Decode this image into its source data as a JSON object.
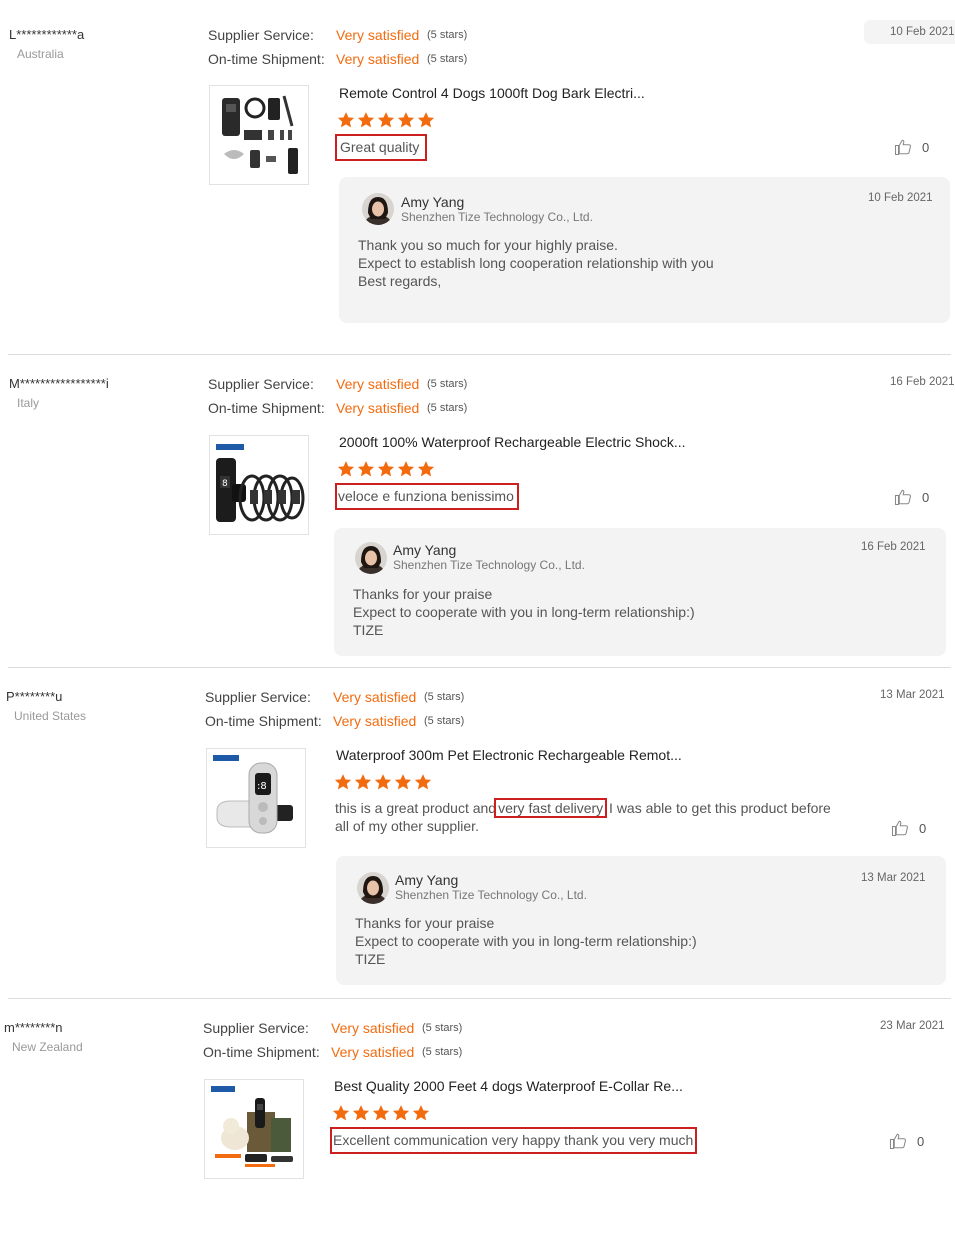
{
  "labels": {
    "supplier_service": "Supplier Service:",
    "ontime_shipment": "On-time Shipment:",
    "like_count": "0"
  },
  "colors": {
    "accent": "#f26b0f",
    "highlight_box": "#cc1f1f",
    "star": "#f26b0f"
  },
  "reviews": [
    {
      "buyer": "L************a",
      "country": "Australia",
      "date": "10 Feb 2021",
      "supplier_service_value": "Very satisfied",
      "supplier_service_stars": "(5 stars)",
      "shipment_value": "Very satisfied",
      "shipment_stars": "(5 stars)",
      "product_title": "Remote Control 4 Dogs 1000ft Dog Bark Electri...",
      "rating": 5,
      "comment": "Great quality",
      "likes": "0",
      "reply": {
        "name": "Amy Yang",
        "company": "Shenzhen Tize Technology Co., Ltd.",
        "date": "10 Feb 2021",
        "lines": [
          "Thank you so much for your highly praise.",
          "Expect to establish long cooperation relationship with you",
          "Best regards,"
        ]
      }
    },
    {
      "buyer": "M*****************i",
      "country": "Italy",
      "date": "16 Feb 2021",
      "supplier_service_value": "Very satisfied",
      "supplier_service_stars": "(5 stars)",
      "shipment_value": "Very satisfied",
      "shipment_stars": "(5 stars)",
      "product_title": "2000ft 100% Waterproof Rechargeable Electric Shock...",
      "rating": 5,
      "comment": "veloce e funziona benissimo",
      "likes": "0",
      "reply": {
        "name": "Amy Yang",
        "company": "Shenzhen Tize Technology Co., Ltd.",
        "date": "16 Feb 2021",
        "lines": [
          "Thanks for your praise",
          "Expect to cooperate with you in long-term relationship:)",
          "TIZE"
        ]
      }
    },
    {
      "buyer": "P********u",
      "country": "United States",
      "date": "13 Mar 2021",
      "supplier_service_value": "Very satisfied",
      "supplier_service_stars": "(5 stars)",
      "shipment_value": "Very satisfied",
      "shipment_stars": "(5 stars)",
      "product_title": "Waterproof 300m Pet Electronic Rechargeable Remot...",
      "rating": 5,
      "comment_before": "this is a great product and",
      "comment_highlight": "very fast delivery",
      "comment_after": " I was able to get this product before",
      "comment_line2": "all of my other supplier.",
      "likes": "0",
      "reply": {
        "name": "Amy Yang",
        "company": "Shenzhen Tize Technology Co., Ltd.",
        "date": "13 Mar 2021",
        "lines": [
          "Thanks for your praise",
          "Expect to cooperate with you in long-term relationship:)",
          "TIZE"
        ]
      }
    },
    {
      "buyer": "m********n",
      "country": "New Zealand",
      "date": "23 Mar 2021",
      "supplier_service_value": "Very satisfied",
      "supplier_service_stars": "(5 stars)",
      "shipment_value": "Very satisfied",
      "shipment_stars": "(5 stars)",
      "product_title": "Best Quality 2000 Feet 4 dogs Waterproof E-Collar Re...",
      "rating": 5,
      "comment": "Excellent communication very happy thank you very much",
      "likes": "0"
    }
  ]
}
